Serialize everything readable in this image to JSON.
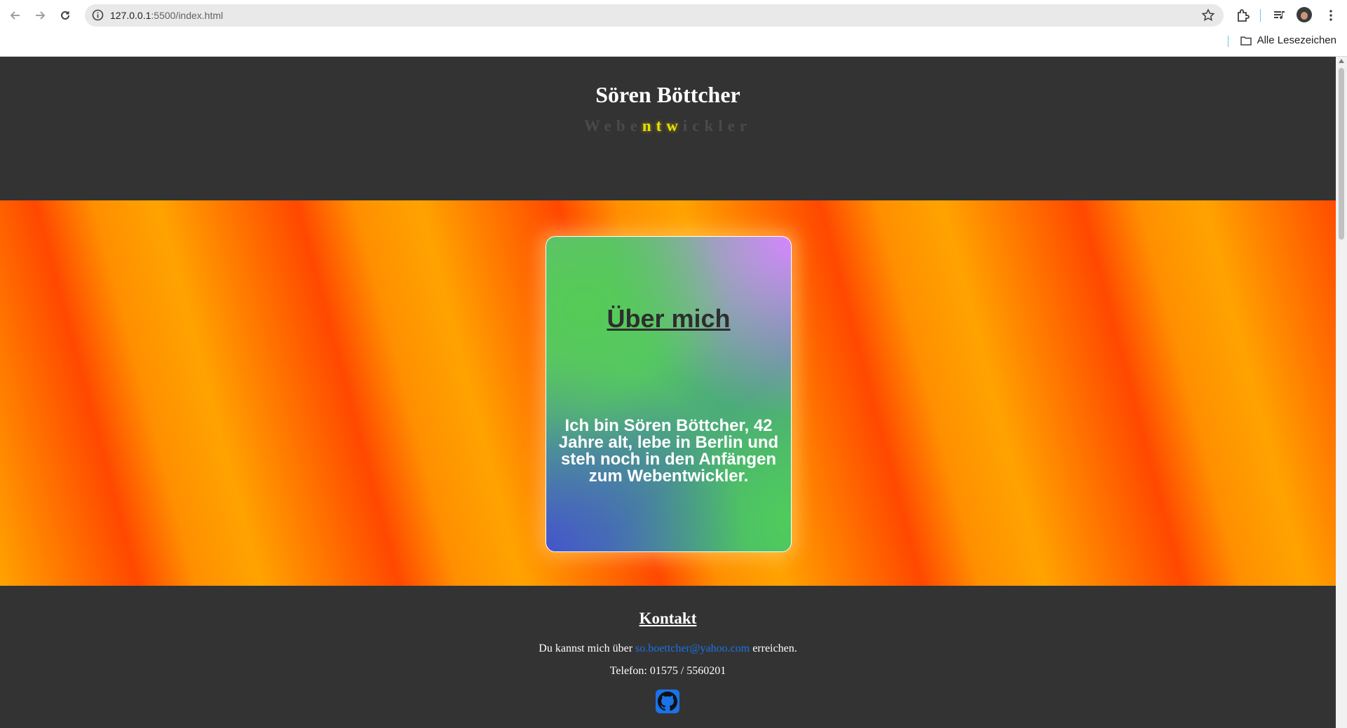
{
  "browser": {
    "url_host": "127.0.0.1",
    "url_rest": ":5500/index.html",
    "bookmarks_label": "Alle Lesezeichen"
  },
  "header": {
    "title": "Sören Böttcher",
    "subtitle_pre": "Webe",
    "subtitle_highlight": "ntw",
    "subtitle_post": "ickler"
  },
  "about": {
    "title": "Über mich",
    "text": "Ich bin Sören Böttcher, 42 Jahre alt, lebe in Berlin und steh noch in den Anfängen zum Webentwickler."
  },
  "contact": {
    "title": "Kontakt",
    "text_before": "Du kannst mich über ",
    "email": "so.boettcher@yahoo.com",
    "text_after": " erreichen.",
    "phone": "Telefon: 01575 / 5560201",
    "github_icon": "github-icon"
  },
  "colors": {
    "header_bg": "#333333",
    "link": "#1a73e8",
    "highlight": "#e8e000"
  }
}
